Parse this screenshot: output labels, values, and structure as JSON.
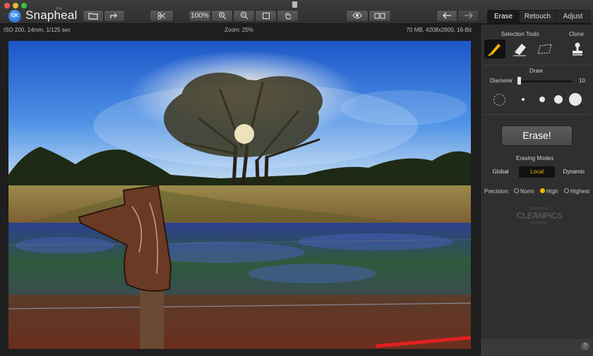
{
  "window": {
    "app_name": "Snapheal",
    "logo_text": "CK",
    "app_subtitle": "Pro"
  },
  "toolbar": {
    "zoom_label": "100%",
    "tabs": [
      "Erase",
      "Retouch",
      "Adjust"
    ]
  },
  "infobar": {
    "left": "ISO 200, 14mm, 1/125 sec",
    "center": "Zoom: 25%",
    "right": "70 MB, 4208x2800, 16-Bit"
  },
  "panel": {
    "selection_tools_title": "Selection Tools",
    "clone_title": "Clone",
    "draw_title": "Draw",
    "diameter_label": "Diameter",
    "diameter_value": "10",
    "erase_button": "Erase!",
    "erasing_modes_title": "Erasing Modes",
    "modes": [
      "Global",
      "Local",
      "Dynamic"
    ],
    "precision_label": "Precision:",
    "precision_options": [
      "Norm",
      "High",
      "Highest"
    ],
    "watermark_small": "powered by",
    "watermark_big": "CLEANPICS",
    "watermark_sub": "technology",
    "help": "?"
  },
  "colors": {
    "accent": "#f0b400",
    "panel_bg": "#2f2f2f",
    "titlebar_bg": "#3a3a3a"
  }
}
